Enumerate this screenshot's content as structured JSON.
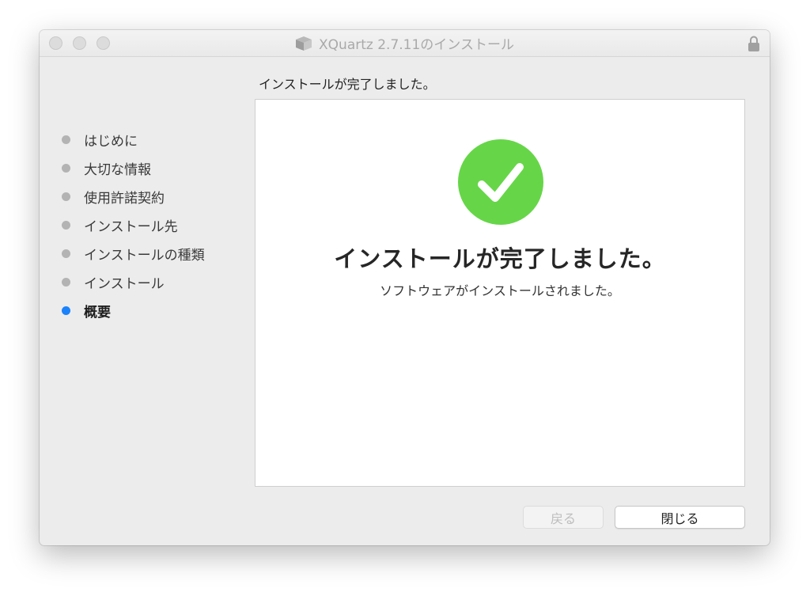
{
  "window": {
    "title": "XQuartz 2.7.11のインストール",
    "title_icon": "package-icon",
    "lock_icon": "lock-icon"
  },
  "heading": "インストールが完了しました。",
  "sidebar": {
    "steps": [
      {
        "label": "はじめに",
        "active": false
      },
      {
        "label": "大切な情報",
        "active": false
      },
      {
        "label": "使用許諾契約",
        "active": false
      },
      {
        "label": "インストール先",
        "active": false
      },
      {
        "label": "インストールの種類",
        "active": false
      },
      {
        "label": "インストール",
        "active": false
      },
      {
        "label": "概要",
        "active": true
      }
    ]
  },
  "main": {
    "status_icon": "checkmark-circle-icon",
    "title": "インストールが完了しました。",
    "message": "ソフトウェアがインストールされました。"
  },
  "buttons": {
    "back_label": "戻る",
    "close_label": "閉じる"
  },
  "colors": {
    "success_green": "#66d648",
    "active_dot": "#1a82fb",
    "inactive_dot": "#b3b3b3"
  }
}
